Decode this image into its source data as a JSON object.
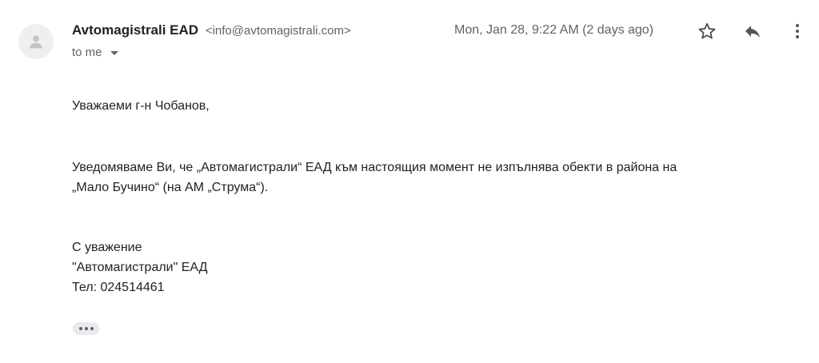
{
  "header": {
    "sender_name": "Avtomagistrali EAD",
    "sender_email": "<info@avtomagistrali.com>",
    "recipient": "to me",
    "date": "Mon, Jan 28, 9:22 AM (2 days ago)"
  },
  "actions": {
    "star_icon": "star-icon",
    "reply_icon": "reply-icon",
    "more_icon": "more-vert-icon"
  },
  "body": {
    "greeting": "Уважаеми г-н Чобанов,",
    "paragraph_line1": "Уведомяваме Ви, че „Автомагистрали“ ЕАД към настоящия момент не изпълнява обекти в района на",
    "paragraph_line2": "„Мало Бучино“  (на АМ „Струма“).",
    "closing_line1": "С уважение",
    "closing_line2": "\"Автомагистрали\" ЕАД",
    "closing_line3": "Тел: 024514461"
  },
  "colors": {
    "text": "#222222",
    "secondary": "#5f6368",
    "avatar_bg": "#efefef",
    "chip_bg": "#e8eaed"
  }
}
